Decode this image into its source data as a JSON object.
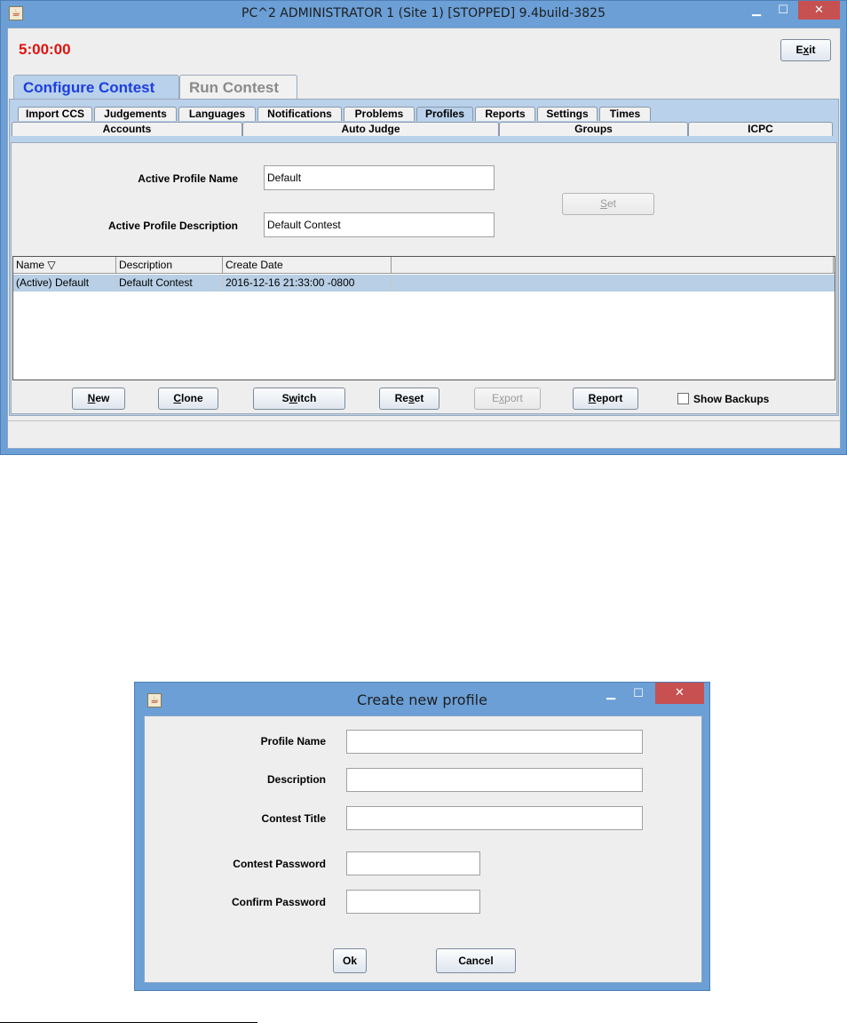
{
  "main": {
    "title": "PC^2 ADMINISTRATOR 1 (Site 1) [STOPPED] 9.4build-3825",
    "clock": "5:00:00",
    "exit_label": "Exit",
    "exit_mnemonic": "x",
    "top_tabs": [
      "Configure Contest",
      "Run Contest"
    ],
    "sub_tabs_row1": [
      "Import CCS",
      "Judgements",
      "Languages",
      "Notifications",
      "Problems",
      "Profiles",
      "Reports",
      "Settings",
      "Times"
    ],
    "sub_tabs_row2": [
      "Accounts",
      "Auto Judge",
      "Groups",
      "ICPC"
    ],
    "active_profile_name_label": "Active Profile Name",
    "active_profile_name_value": "Default",
    "active_profile_description_label": "Active Profile Description",
    "active_profile_description_value": "Default Contest",
    "set_label": "Set",
    "table": {
      "columns": [
        "Name ▽",
        "Description",
        "Create Date",
        ""
      ],
      "rows": [
        [
          "(Active) Default",
          "Default Contest",
          "2016-12-16 21:33:00 -0800",
          ""
        ]
      ]
    },
    "buttons": [
      "New",
      "Clone",
      "Switch",
      "Reset",
      "Export",
      "Report"
    ],
    "show_backups_label": "Show Backups",
    "show_backups_checked": false
  },
  "dialog": {
    "title": "Create new profile",
    "fields": [
      {
        "label": "Profile Name",
        "value": ""
      },
      {
        "label": "Description",
        "value": ""
      },
      {
        "label": "Contest Title",
        "value": ""
      },
      {
        "label": "Contest Password",
        "value": ""
      },
      {
        "label": "Confirm Password",
        "value": ""
      }
    ],
    "ok_label": "Ok",
    "cancel_label": "Cancel"
  },
  "icons": {
    "app": "java-coffee-icon",
    "minimize": "minimize-icon",
    "maximize": "maximize-icon",
    "close": "close-icon"
  },
  "colors": {
    "titlebar": "#6b9fd6",
    "clock": "#e0130f",
    "active_tab_text": "#1c3ee0",
    "selected_row": "#b8cfe5",
    "close_button": "#c75050"
  }
}
